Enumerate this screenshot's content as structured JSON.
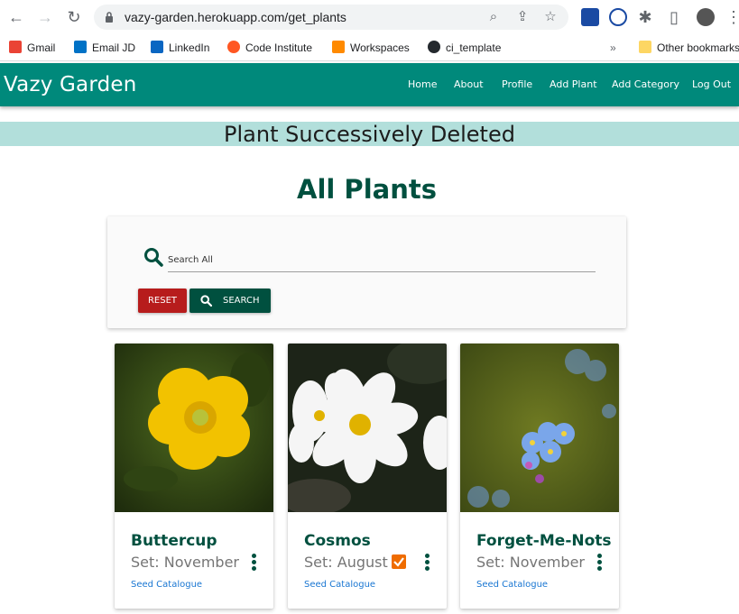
{
  "browser": {
    "url": "vazy-garden.herokuapp.com/get_plants",
    "bookmarks": [
      {
        "label": "Gmail",
        "icon": "gmail-icon",
        "color": "#ea4335"
      },
      {
        "label": "Email JD",
        "icon": "outlook-icon",
        "color": "#0072c6"
      },
      {
        "label": "LinkedIn",
        "icon": "linkedin-icon",
        "color": "#0a66c2"
      },
      {
        "label": "Code Institute",
        "icon": "code-institute-icon",
        "color": "#ff5722"
      },
      {
        "label": "Workspaces",
        "icon": "gitpod-icon",
        "color": "#ff8a00"
      },
      {
        "label": "ci_template",
        "icon": "github-icon",
        "color": "#24292e"
      }
    ],
    "overflow_label": "»",
    "other_bookmarks": "Other bookmarks"
  },
  "navbar": {
    "brand": "Vazy Garden",
    "links": [
      "Home",
      "About",
      "Profile",
      "Add Plant",
      "Add Category",
      "Log Out"
    ],
    "color": "#00897b"
  },
  "flash": {
    "message": "Plant Successively Deleted",
    "color": "#b2dfdb"
  },
  "page": {
    "title": "All Plants"
  },
  "search": {
    "placeholder": "Search All",
    "reset_label": "RESET",
    "search_label": "SEARCH"
  },
  "plants": [
    {
      "name": "Buttercup",
      "set": "Set: November",
      "checked": false,
      "link": "Seed Catalogue"
    },
    {
      "name": "Cosmos",
      "set": "Set: August",
      "checked": true,
      "link": "Seed Catalogue"
    },
    {
      "name": "Forget-Me-Nots",
      "set": "Set: November",
      "checked": false,
      "link": "Seed Catalogue"
    }
  ],
  "colors": {
    "primary_dark": "#00503f",
    "danger": "#b71c1c",
    "link": "#1976d2",
    "checkbox": "#ef6c00"
  }
}
